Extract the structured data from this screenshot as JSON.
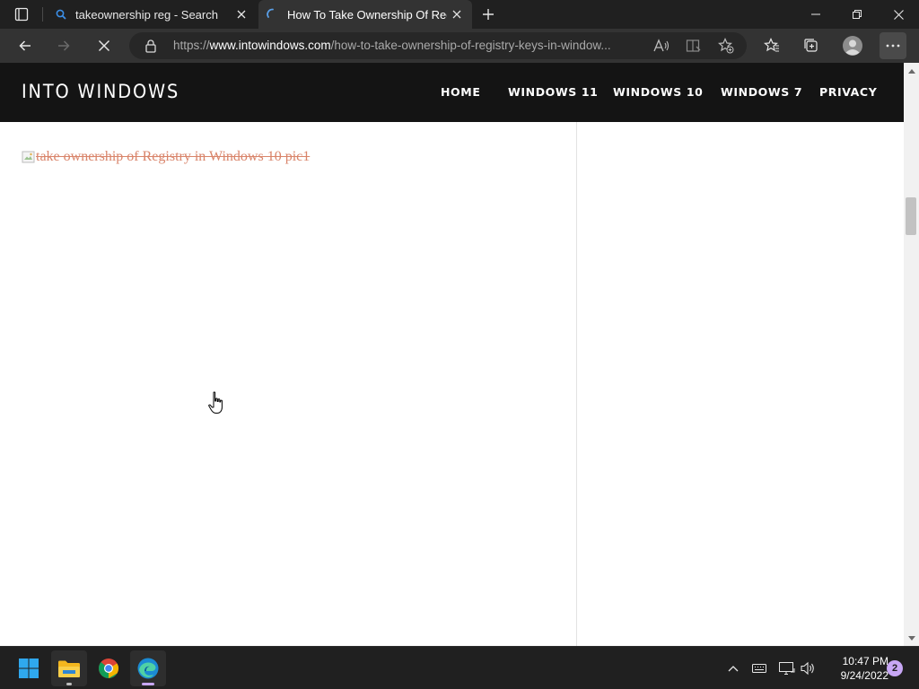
{
  "browser": {
    "tabs": [
      {
        "title": "takeownership reg - Search",
        "icon": "search-icon",
        "active": false
      },
      {
        "title": "How To Take Ownership Of Registry Keys",
        "icon": "loading-spinner-icon",
        "active": true
      }
    ],
    "address": {
      "scheme": "https://",
      "host": "www.intowindows.com",
      "path": "/how-to-take-ownership-of-registry-keys-in-window..."
    },
    "colors": {
      "chrome": "#202020",
      "toolbar": "#333333",
      "address_bg": "#272727"
    }
  },
  "site": {
    "logo": "INTO WINDOWS",
    "nav": [
      "HOME",
      "WINDOWS 11",
      "WINDOWS 10",
      "WINDOWS 7",
      "PRIVACY"
    ],
    "header_bg": "#141414"
  },
  "content": {
    "broken_image_alt": "take ownership of Registry in Windows 10 pic1",
    "link_color": "#d9846a"
  },
  "taskbar": {
    "apps": [
      "start-icon",
      "file-explorer-icon",
      "chrome-icon",
      "edge-icon"
    ],
    "clock": {
      "time": "10:47 PM",
      "date": "9/24/2022"
    },
    "notification_count": "2"
  }
}
